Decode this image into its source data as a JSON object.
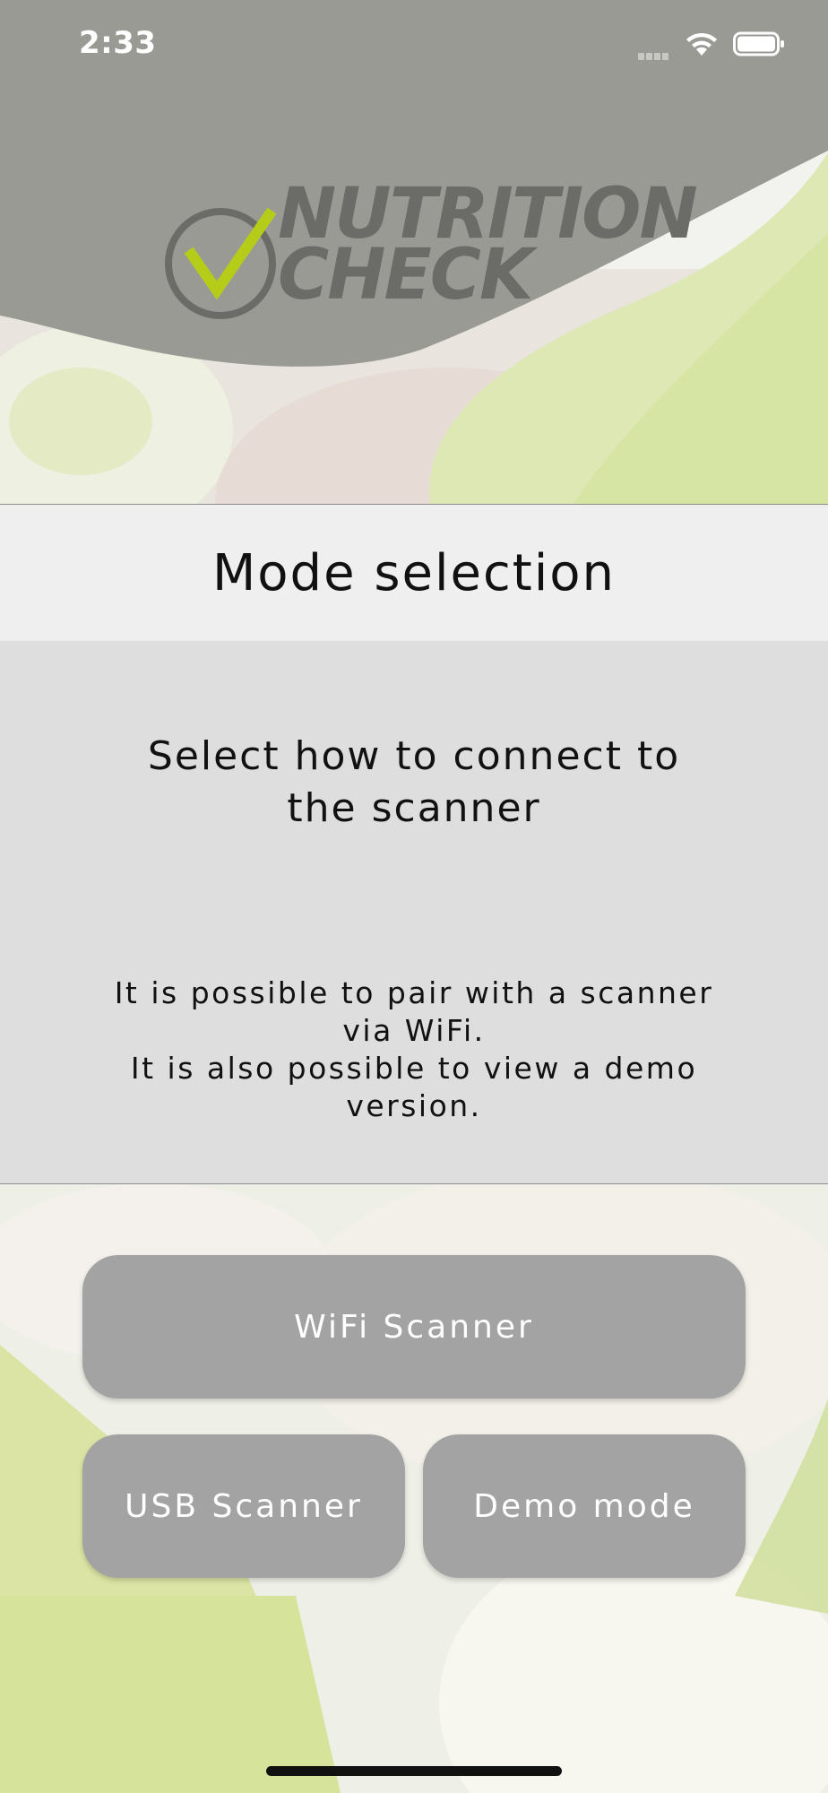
{
  "status_bar": {
    "time": "2:33"
  },
  "logo": {
    "line1": "NUTRITION",
    "line2": "CHECK"
  },
  "header": {
    "title": "Mode selection"
  },
  "info": {
    "subtitle": "Select how to connect to the scanner",
    "desc_line1": "It is possible to pair with a scanner via WiFi.",
    "desc_line2": "It is also possible to view a demo version."
  },
  "buttons": {
    "wifi_label": "WiFi Scanner",
    "usb_label": "USB Scanner",
    "demo_label": "Demo mode"
  },
  "colors": {
    "header_gray": "#9a9a95",
    "accent_green": "#b5cc18",
    "button_gray": "#a3a3a3"
  }
}
